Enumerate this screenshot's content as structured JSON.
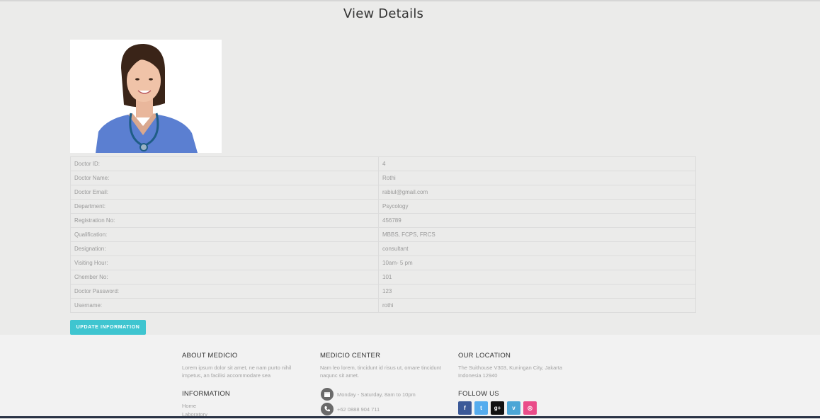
{
  "page": {
    "title": "View Details"
  },
  "details": [
    {
      "label": "Doctor ID:",
      "value": "4"
    },
    {
      "label": "Doctor Name:",
      "value": "Rothi"
    },
    {
      "label": "Doctor Email:",
      "value": "rabiul@gmail.com"
    },
    {
      "label": "Department:",
      "value": "Psycology"
    },
    {
      "label": "Registration No:",
      "value": "456789"
    },
    {
      "label": "Qualification:",
      "value": "MBBS, FCPS, FRCS"
    },
    {
      "label": "Designation:",
      "value": "consultant"
    },
    {
      "label": "Visiting Hour:",
      "value": "10am- 5 pm"
    },
    {
      "label": "Chember No:",
      "value": "101"
    },
    {
      "label": "Doctor Password:",
      "value": "123"
    },
    {
      "label": "Username:",
      "value": "rothi"
    }
  ],
  "actions": {
    "update_label": "UPDATE INFORMATION"
  },
  "footer": {
    "about": {
      "heading": "ABOUT MEDICIO",
      "text": "Lorem ipsum dolor sit amet, ne nam purto nihil impetus, an facilisi accommodare sea"
    },
    "information": {
      "heading": "INFORMATION",
      "links": [
        "Home",
        "Laboratory"
      ]
    },
    "center": {
      "heading": "MEDICIO CENTER",
      "text": "Nam leo lorem, tincidunt id risus ut, ornare tincidunt naqunc sit amet.",
      "hours": "Monday - Saturday, 8am to 10pm",
      "phone": "+62 0888 904 711"
    },
    "location": {
      "heading": "OUR LOCATION",
      "text": "The Suithouse V303, Kuningan City, Jakarta Indonesia 12940"
    },
    "follow": {
      "heading": "FOLLOW US",
      "icons": [
        {
          "name": "facebook-icon",
          "glyph": "f",
          "color": "#3b5998"
        },
        {
          "name": "twitter-icon",
          "glyph": "t",
          "color": "#55acee"
        },
        {
          "name": "google-plus-icon",
          "glyph": "g+",
          "color": "#111111"
        },
        {
          "name": "vimeo-icon",
          "glyph": "v",
          "color": "#4ca6d6"
        },
        {
          "name": "dribbble-icon",
          "glyph": "◎",
          "color": "#ea4c89"
        }
      ]
    }
  },
  "colors": {
    "accent": "#3fc5d0",
    "background": "#ebebea",
    "footer_bg": "#f2f2f2"
  }
}
